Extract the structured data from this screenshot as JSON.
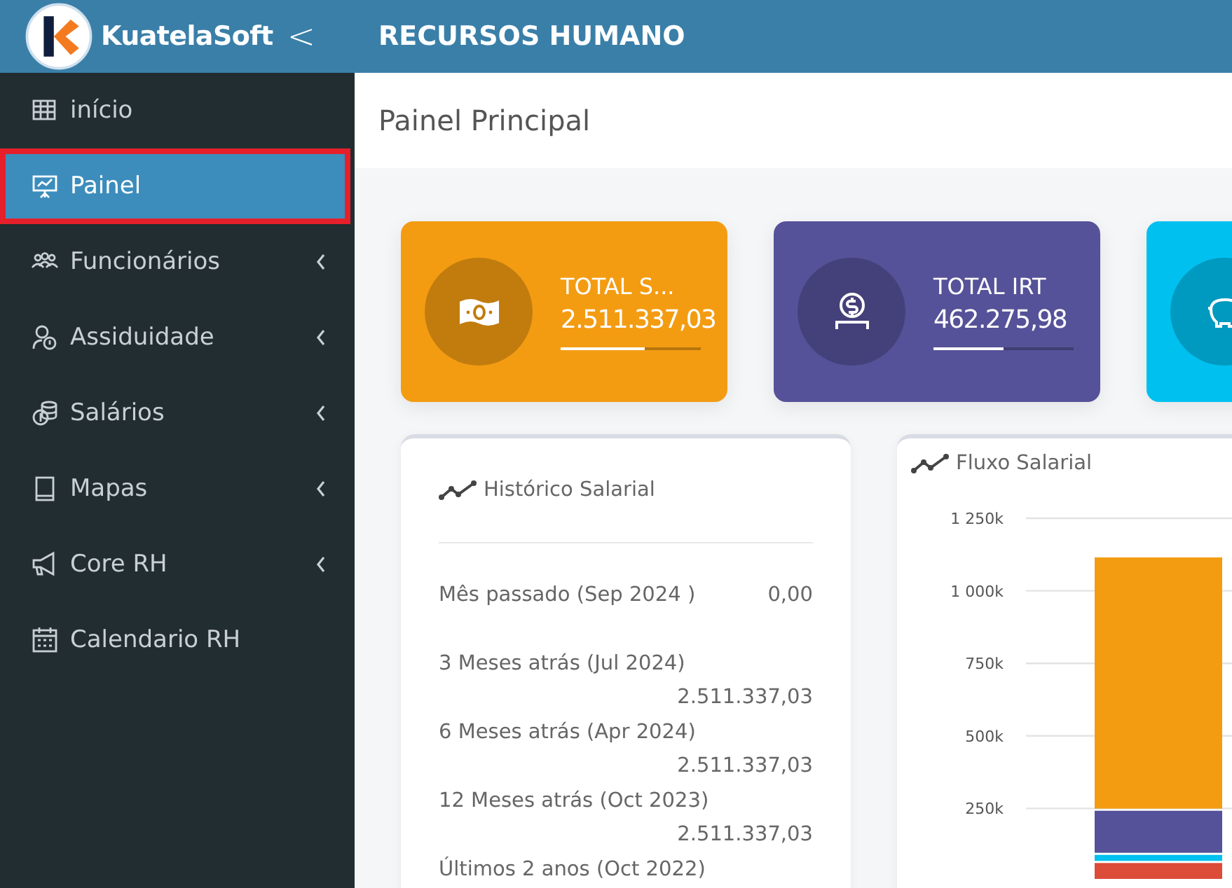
{
  "brand": {
    "name": "KuatelaSoft",
    "collapse": "<"
  },
  "header": {
    "title": "RECURSOS HUMANO"
  },
  "sidebar": {
    "items": [
      {
        "label": "início",
        "selected": false,
        "expandable": false
      },
      {
        "label": "Painel",
        "selected": true,
        "expandable": false
      },
      {
        "label": "Funcionários",
        "selected": false,
        "expandable": true
      },
      {
        "label": "Assiduidade",
        "selected": false,
        "expandable": true
      },
      {
        "label": "Salários",
        "selected": false,
        "expandable": true
      },
      {
        "label": "Mapas",
        "selected": false,
        "expandable": true
      },
      {
        "label": "Core RH",
        "selected": false,
        "expandable": true
      },
      {
        "label": "Calendario RH",
        "selected": false,
        "expandable": false
      }
    ]
  },
  "page": {
    "title": "Painel Principal"
  },
  "stats": [
    {
      "title": "TOTAL S...",
      "value": "2.511.337,03",
      "level": 0.6,
      "color": "#f39c12"
    },
    {
      "title": "TOTAL IRT",
      "value": "462.275,98",
      "level": 0.5,
      "color": "#555299"
    },
    {
      "color": "#00c0ef"
    }
  ],
  "history": {
    "title": "Histórico Salarial",
    "rows": [
      {
        "label": "Mês passado (Sep 2024 )",
        "value": "0,00",
        "kind": "inline"
      },
      {
        "label": "3 Meses atrás (Jul 2024)",
        "value": "2.511.337,03",
        "kind": "wrapped"
      },
      {
        "label": "6 Meses atrás (Apr 2024)",
        "value": "2.511.337,03",
        "kind": "wrapped"
      },
      {
        "label": "12 Meses atrás (Oct 2023)",
        "value": "2.511.337,03",
        "kind": "wrapped"
      },
      {
        "label": "Últimos 2 anos (Oct 2022)",
        "kind": "wrapped"
      }
    ]
  },
  "flow": {
    "title": "Fluxo Salarial",
    "chart_data": {
      "type": "bar",
      "stacked": true,
      "grid": true,
      "categories": [
        null
      ],
      "series": [
        {
          "color": "#dd4b39",
          "values": [
            62000
          ]
        },
        {
          "color": "#00c0ef",
          "values": [
            28000
          ]
        },
        {
          "color": "#555299",
          "values": [
            152000
          ]
        },
        {
          "color": "#f39c12",
          "values": [
            873000
          ]
        }
      ],
      "ylim": [
        0,
        1250000
      ],
      "yticks": [
        {
          "value": 250000,
          "label": "250k"
        },
        {
          "value": 500000,
          "label": "500k"
        },
        {
          "value": 750000,
          "label": "750k"
        },
        {
          "value": 1000000,
          "label": "1 000k"
        },
        {
          "value": 1250000,
          "label": "1 250k"
        }
      ]
    }
  }
}
